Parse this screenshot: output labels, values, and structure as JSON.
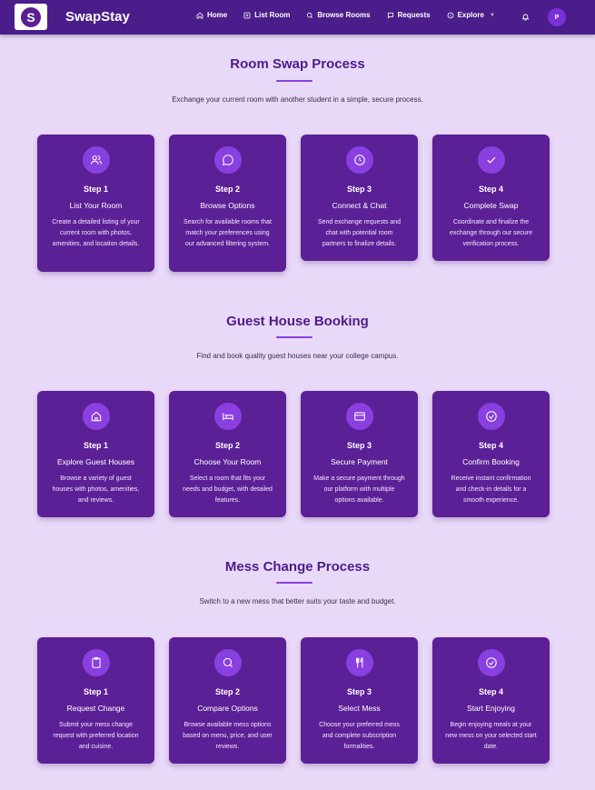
{
  "nav": {
    "logo_letter": "S",
    "brand": "SwapStay",
    "links": [
      {
        "label": "Home",
        "icon": "home-icon"
      },
      {
        "label": "List Room",
        "icon": "plus-square-icon"
      },
      {
        "label": "Browse Rooms",
        "icon": "search-icon"
      },
      {
        "label": "Requests",
        "icon": "message-icon"
      },
      {
        "label": "Explore",
        "icon": "info-icon"
      }
    ],
    "bell_icon": "bell-icon",
    "avatar_initial": "P"
  },
  "sections": [
    {
      "title": "Room Swap Process",
      "subtitle": "Exchange your current room with another student in a simple, secure process.",
      "steps": [
        {
          "step": "Step 1",
          "title": "List Your Room",
          "desc": "Create a detailed listing of your current room with photos, amenities, and location details.",
          "icon": "users-icon"
        },
        {
          "step": "Step 2",
          "title": "Browse Options",
          "desc": "Search for available rooms that match your preferences using our advanced filtering system.",
          "icon": "chat-bubble-icon"
        },
        {
          "step": "Step 3",
          "title": "Connect & Chat",
          "desc": "Send exchange requests and chat with potential room partners to finalize details.",
          "icon": "clock-icon"
        },
        {
          "step": "Step 4",
          "title": "Complete Swap",
          "desc": "Coordinate and finalize the exchange through our secure verification process.",
          "icon": "check-icon"
        }
      ]
    },
    {
      "title": "Guest House Booking",
      "subtitle": "Find and book quality guest houses near your college campus.",
      "steps": [
        {
          "step": "Step 1",
          "title": "Explore Guest Houses",
          "desc": "Browse a variety of guest houses with photos, amenities, and reviews.",
          "icon": "house-icon"
        },
        {
          "step": "Step 2",
          "title": "Choose Your Room",
          "desc": "Select a room that fits your needs and budget, with detailed features.",
          "icon": "bed-icon"
        },
        {
          "step": "Step 3",
          "title": "Secure Payment",
          "desc": "Make a secure payment through our platform with multiple options available.",
          "icon": "credit-card-icon"
        },
        {
          "step": "Step 4",
          "title": "Confirm Booking",
          "desc": "Receive instant confirmation and check-in details for a smooth experience.",
          "icon": "check-circle-icon"
        }
      ]
    },
    {
      "title": "Mess Change Process",
      "subtitle": "Switch to a new mess that better suits your taste and budget.",
      "steps": [
        {
          "step": "Step 1",
          "title": "Request Change",
          "desc": "Submit your mess change request with preferred location and cuisine.",
          "icon": "clipboard-icon"
        },
        {
          "step": "Step 2",
          "title": "Compare Options",
          "desc": "Browse available mess options based on menu, price, and user reviews.",
          "icon": "search-icon"
        },
        {
          "step": "Step 3",
          "title": "Select Mess",
          "desc": "Choose your preferred mess and complete subscription formalities.",
          "icon": "utensils-icon"
        },
        {
          "step": "Step 4",
          "title": "Start Enjoying",
          "desc": "Begin enjoying meals at your new mess on your selected start date.",
          "icon": "check-circle-icon"
        }
      ]
    }
  ]
}
